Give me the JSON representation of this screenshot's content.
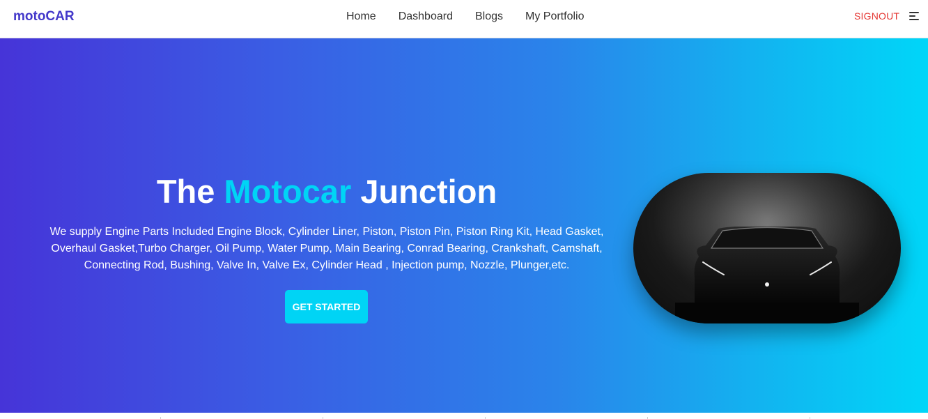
{
  "nav": {
    "brand": "motoCAR",
    "links": [
      {
        "label": "Home"
      },
      {
        "label": "Dashboard"
      },
      {
        "label": "Blogs"
      },
      {
        "label": "My Portfolio"
      }
    ],
    "signout_label": "SIGNOUT",
    "menu_icon": "hamburger-menu-icon"
  },
  "hero": {
    "title_part1": "The ",
    "title_accent": "Motocar",
    "title_part2": " Junction",
    "description": "We supply Engine Parts Included Engine Block, Cylinder Liner, Piston, Piston Pin, Piston Ring Kit, Head Gasket, Overhaul Gasket,Turbo Charger, Oil Pump, Water Pump, Main Bearing, Conrad Bearing, Crankshaft, Camshaft, Connecting Rod, Bushing, Valve In, Valve Ex, Cylinder Head , Injection pump, Nozzle, Plunger,etc.",
    "cta_label": "GET STARTED",
    "image": "dark-car-front-image"
  },
  "colors": {
    "brand": "#4338ca",
    "accent": "#00d4f5",
    "signout": "#e53935",
    "gradient_start": "#4634d8",
    "gradient_end": "#00d6f8"
  }
}
